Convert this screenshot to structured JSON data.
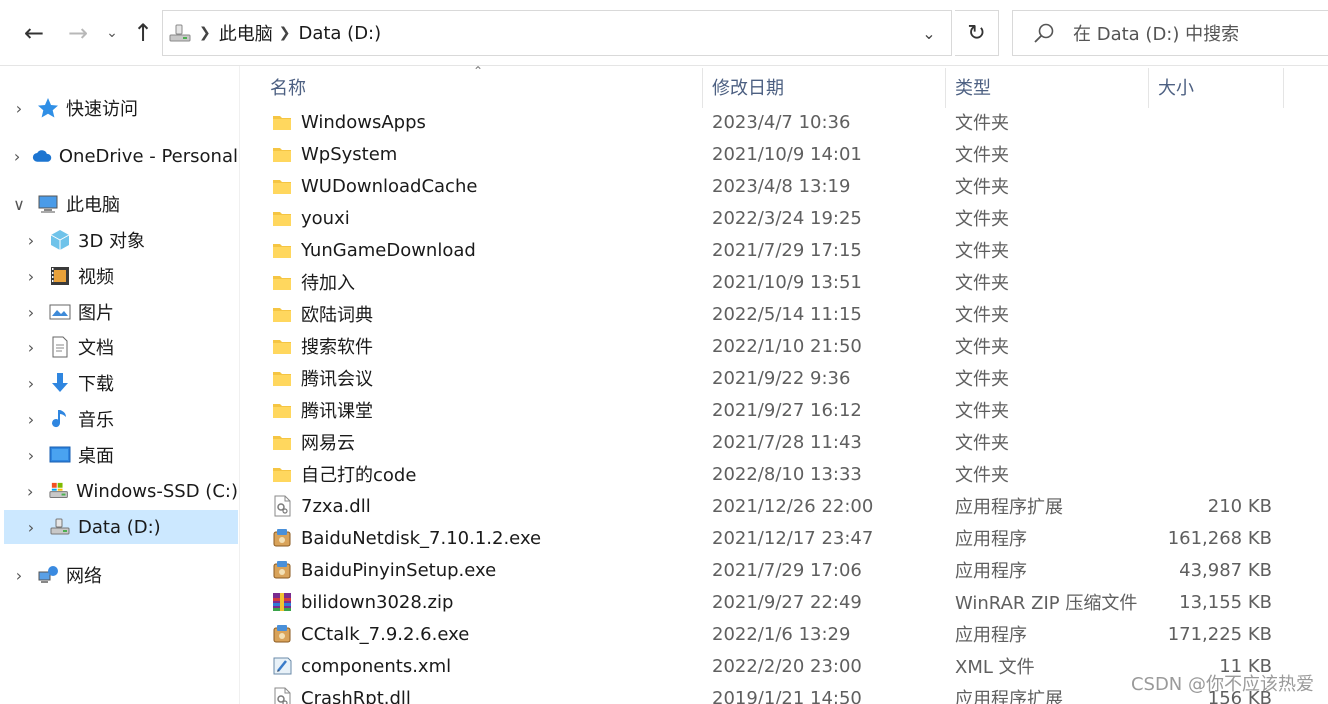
{
  "toolbar": {
    "breadcrumb": [
      "此电脑",
      "Data (D:)"
    ],
    "search_placeholder": "在 Data (D:) 中搜索"
  },
  "sidebar": {
    "items": [
      {
        "label": "快速访问",
        "icon": "star-icon",
        "expand": "collapsed"
      },
      {
        "label": "OneDrive - Personal",
        "icon": "cloud-icon",
        "expand": "collapsed"
      },
      {
        "label": "此电脑",
        "icon": "computer-icon",
        "expand": "expanded"
      },
      {
        "label": "3D 对象",
        "icon": "cube-icon",
        "expand": "collapsed"
      },
      {
        "label": "视频",
        "icon": "video-icon",
        "expand": "collapsed"
      },
      {
        "label": "图片",
        "icon": "pictures-icon",
        "expand": "collapsed"
      },
      {
        "label": "文档",
        "icon": "documents-icon",
        "expand": "collapsed"
      },
      {
        "label": "下载",
        "icon": "download-icon",
        "expand": "collapsed"
      },
      {
        "label": "音乐",
        "icon": "music-icon",
        "expand": "collapsed"
      },
      {
        "label": "桌面",
        "icon": "desktop-icon",
        "expand": "collapsed"
      },
      {
        "label": "Windows-SSD (C:)",
        "icon": "drive-c-icon",
        "expand": "collapsed"
      },
      {
        "label": "Data (D:)",
        "icon": "drive-d-icon",
        "expand": "collapsed",
        "selected": true
      },
      {
        "label": "网络",
        "icon": "network-icon",
        "expand": "collapsed"
      }
    ]
  },
  "columns": {
    "name": "名称",
    "date": "修改日期",
    "type": "类型",
    "size": "大小"
  },
  "files": [
    {
      "name": "WindowsApps",
      "date": "2023/4/7 10:36",
      "type": "文件夹",
      "size": "",
      "icon": "folder-icon"
    },
    {
      "name": "WpSystem",
      "date": "2021/10/9 14:01",
      "type": "文件夹",
      "size": "",
      "icon": "folder-icon"
    },
    {
      "name": "WUDownloadCache",
      "date": "2023/4/8 13:19",
      "type": "文件夹",
      "size": "",
      "icon": "folder-icon"
    },
    {
      "name": "youxi",
      "date": "2022/3/24 19:25",
      "type": "文件夹",
      "size": "",
      "icon": "folder-icon"
    },
    {
      "name": "YunGameDownload",
      "date": "2021/7/29 17:15",
      "type": "文件夹",
      "size": "",
      "icon": "folder-icon"
    },
    {
      "name": "待加入",
      "date": "2021/10/9 13:51",
      "type": "文件夹",
      "size": "",
      "icon": "folder-icon"
    },
    {
      "name": "欧陆词典",
      "date": "2022/5/14 11:15",
      "type": "文件夹",
      "size": "",
      "icon": "folder-icon"
    },
    {
      "name": "搜索软件",
      "date": "2022/1/10 21:50",
      "type": "文件夹",
      "size": "",
      "icon": "folder-icon"
    },
    {
      "name": "腾讯会议",
      "date": "2021/9/22 9:36",
      "type": "文件夹",
      "size": "",
      "icon": "folder-icon"
    },
    {
      "name": "腾讯课堂",
      "date": "2021/9/27 16:12",
      "type": "文件夹",
      "size": "",
      "icon": "folder-icon"
    },
    {
      "name": "网易云",
      "date": "2021/7/28 11:43",
      "type": "文件夹",
      "size": "",
      "icon": "folder-icon"
    },
    {
      "name": "自己打的code",
      "date": "2022/8/10 13:33",
      "type": "文件夹",
      "size": "",
      "icon": "folder-icon"
    },
    {
      "name": "7zxa.dll",
      "date": "2021/12/26 22:00",
      "type": "应用程序扩展",
      "size": "210 KB",
      "icon": "dll-icon"
    },
    {
      "name": "BaiduNetdisk_7.10.1.2.exe",
      "date": "2021/12/17 23:47",
      "type": "应用程序",
      "size": "161,268 KB",
      "icon": "installer-icon"
    },
    {
      "name": "BaiduPinyinSetup.exe",
      "date": "2021/7/29 17:06",
      "type": "应用程序",
      "size": "43,987 KB",
      "icon": "installer-icon"
    },
    {
      "name": "bilidown3028.zip",
      "date": "2021/9/27 22:49",
      "type": "WinRAR ZIP 压缩文件",
      "size": "13,155 KB",
      "icon": "winrar-icon"
    },
    {
      "name": "CCtalk_7.9.2.6.exe",
      "date": "2022/1/6 13:29",
      "type": "应用程序",
      "size": "171,225 KB",
      "icon": "installer-icon"
    },
    {
      "name": "components.xml",
      "date": "2022/2/20 23:00",
      "type": "XML 文件",
      "size": "11 KB",
      "icon": "xml-icon"
    },
    {
      "name": "CrashRpt.dll",
      "date": "2019/1/21 14:50",
      "type": "应用程序扩展",
      "size": "156 KB",
      "icon": "dll-icon"
    }
  ],
  "watermark": "CSDN @你不应该热爱"
}
